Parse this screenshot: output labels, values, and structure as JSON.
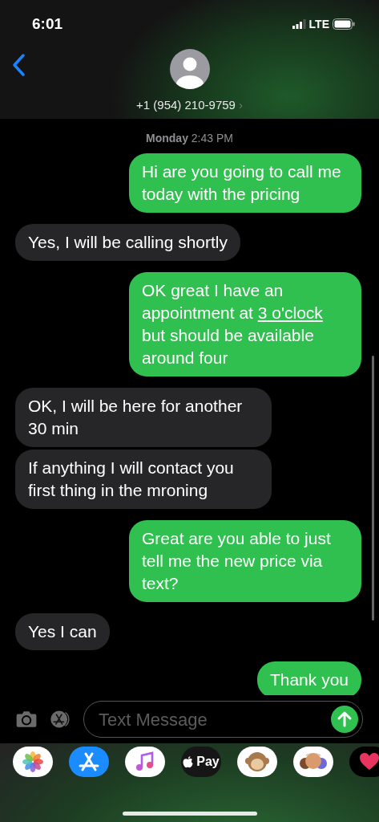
{
  "status_bar": {
    "time": "6:01",
    "network": "LTE"
  },
  "contact": {
    "name": "+1 (954) 210-9759",
    "chevron": "›"
  },
  "timestamp": {
    "day": "Monday",
    "time": "2:43 PM"
  },
  "messages": [
    {
      "kind": "sent",
      "text": "Hi are you going to call me today with the pricing"
    },
    {
      "kind": "received",
      "text": "Yes, I will be calling shortly"
    },
    {
      "kind": "sent",
      "parts": [
        {
          "text": "OK great I have an appointment at ",
          "link": false
        },
        {
          "text": "3 o'clock",
          "link": true
        },
        {
          "text": " but should be available around four",
          "link": false
        }
      ]
    },
    {
      "kind": "received",
      "text": "OK, I will be here for another 30 min"
    },
    {
      "kind": "received",
      "text": "If anything I will contact you first thing in the mroning"
    },
    {
      "kind": "sent",
      "text": "Great are you able to just tell me the new price via text?"
    },
    {
      "kind": "received",
      "text": "Yes I can"
    },
    {
      "kind": "sent",
      "text": "Thank you"
    }
  ],
  "composer": {
    "placeholder": "Text Message"
  },
  "apps": [
    {
      "kind": "photos"
    },
    {
      "kind": "store"
    },
    {
      "kind": "music"
    },
    {
      "kind": "pay",
      "label": "Pay"
    },
    {
      "kind": "animal"
    },
    {
      "kind": "people"
    },
    {
      "kind": "heart"
    }
  ]
}
